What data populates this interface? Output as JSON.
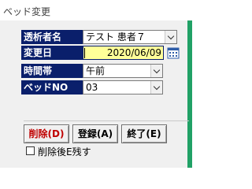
{
  "window": {
    "title": "ベッド変更"
  },
  "form": {
    "patient": {
      "label": "透析者名",
      "value": "テスト 患者７"
    },
    "date": {
      "label": "変更日",
      "value": "2020/06/09"
    },
    "timeslot": {
      "label": "時間帯",
      "value": "午前"
    },
    "bed": {
      "label": "ベッドNO",
      "value": "03"
    }
  },
  "buttons": {
    "delete": "削除(D)",
    "register": "登録(A)",
    "close": "終了(E)"
  },
  "checkbox": {
    "label": "削除後E残す",
    "checked": false
  },
  "colors": {
    "label_bg": "#0a1f6b",
    "date_bg": "#ffff99",
    "accent_strip": "#21a166",
    "delete_text": "#c00000"
  }
}
